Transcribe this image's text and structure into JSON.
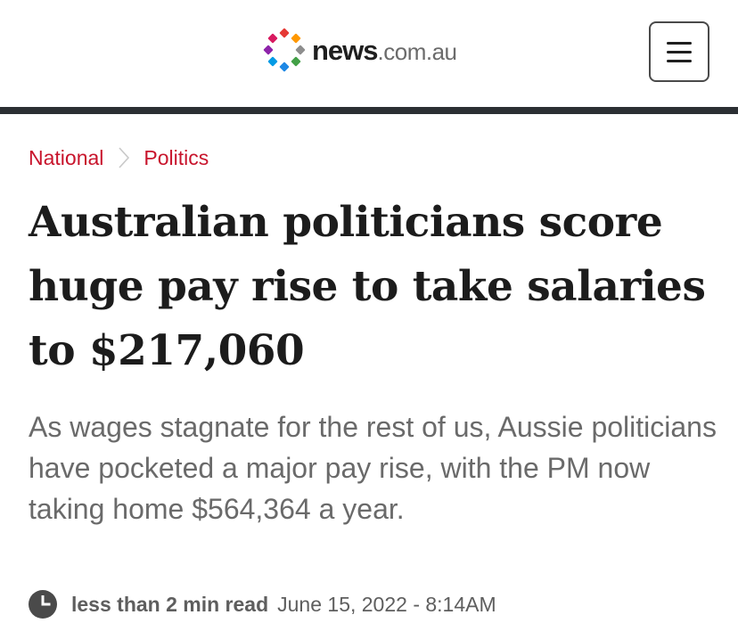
{
  "header": {
    "logo": {
      "name": "news",
      "domain": ".com.au"
    },
    "menu_icon": "hamburger-menu-icon"
  },
  "breadcrumb": {
    "items": [
      {
        "label": "National"
      },
      {
        "label": "Politics"
      }
    ],
    "separator_icon": "chevron-right-icon"
  },
  "article": {
    "headline": "Australian politicians score huge pay rise to take salaries to $217,060",
    "standfirst": "As wages stagnate for the rest of us, Aussie politicians have pocketed a major pay rise, with the PM now taking home $564,364 a year.",
    "read_time": "less than 2 min read",
    "timestamp": "June 15, 2022 - 8:14AM",
    "read_time_icon": "clock-icon"
  },
  "colors": {
    "brand_red": "#c8142c",
    "header_rule": "#2b2f33",
    "headline": "#1c1c1c",
    "standfirst": "#6a6a6a"
  }
}
